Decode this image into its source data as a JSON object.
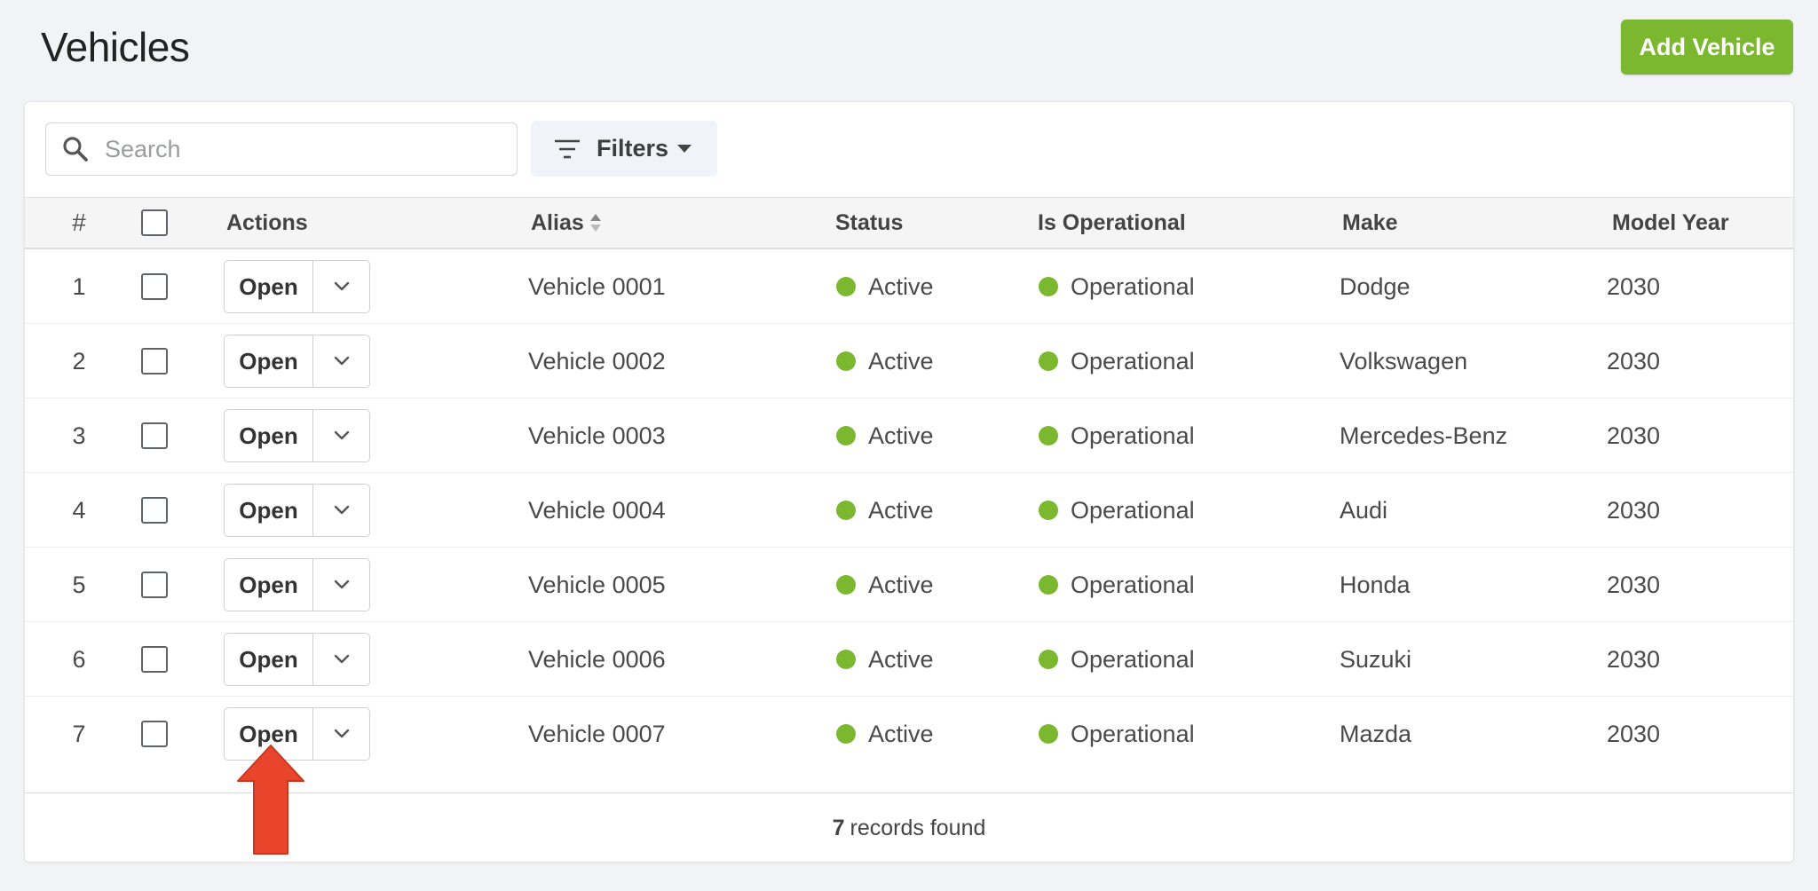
{
  "page": {
    "title": "Vehicles",
    "add_button_label": "Add Vehicle",
    "accent_color": "#7cb82f",
    "annotation_arrow_color": "#e8452c"
  },
  "toolbar": {
    "search_placeholder": "Search",
    "filters_label": "Filters"
  },
  "table": {
    "columns": {
      "number": "#",
      "actions": "Actions",
      "alias": "Alias",
      "status": "Status",
      "is_operational": "Is Operational",
      "make": "Make",
      "model_year": "Model Year"
    },
    "rows": [
      {
        "num": "1",
        "open": "Open",
        "alias": "Vehicle 0001",
        "status": "Active",
        "operational": "Operational",
        "make": "Dodge",
        "year": "2030"
      },
      {
        "num": "2",
        "open": "Open",
        "alias": "Vehicle 0002",
        "status": "Active",
        "operational": "Operational",
        "make": "Volkswagen",
        "year": "2030"
      },
      {
        "num": "3",
        "open": "Open",
        "alias": "Vehicle 0003",
        "status": "Active",
        "operational": "Operational",
        "make": "Mercedes-Benz",
        "year": "2030"
      },
      {
        "num": "4",
        "open": "Open",
        "alias": "Vehicle 0004",
        "status": "Active",
        "operational": "Operational",
        "make": "Audi",
        "year": "2030"
      },
      {
        "num": "5",
        "open": "Open",
        "alias": "Vehicle 0005",
        "status": "Active",
        "operational": "Operational",
        "make": "Honda",
        "year": "2030"
      },
      {
        "num": "6",
        "open": "Open",
        "alias": "Vehicle 0006",
        "status": "Active",
        "operational": "Operational",
        "make": "Suzuki",
        "year": "2030"
      },
      {
        "num": "7",
        "open": "Open",
        "alias": "Vehicle 0007",
        "status": "Active",
        "operational": "Operational",
        "make": "Mazda",
        "year": "2030"
      }
    ]
  },
  "footer": {
    "count": "7",
    "label": "records found"
  }
}
